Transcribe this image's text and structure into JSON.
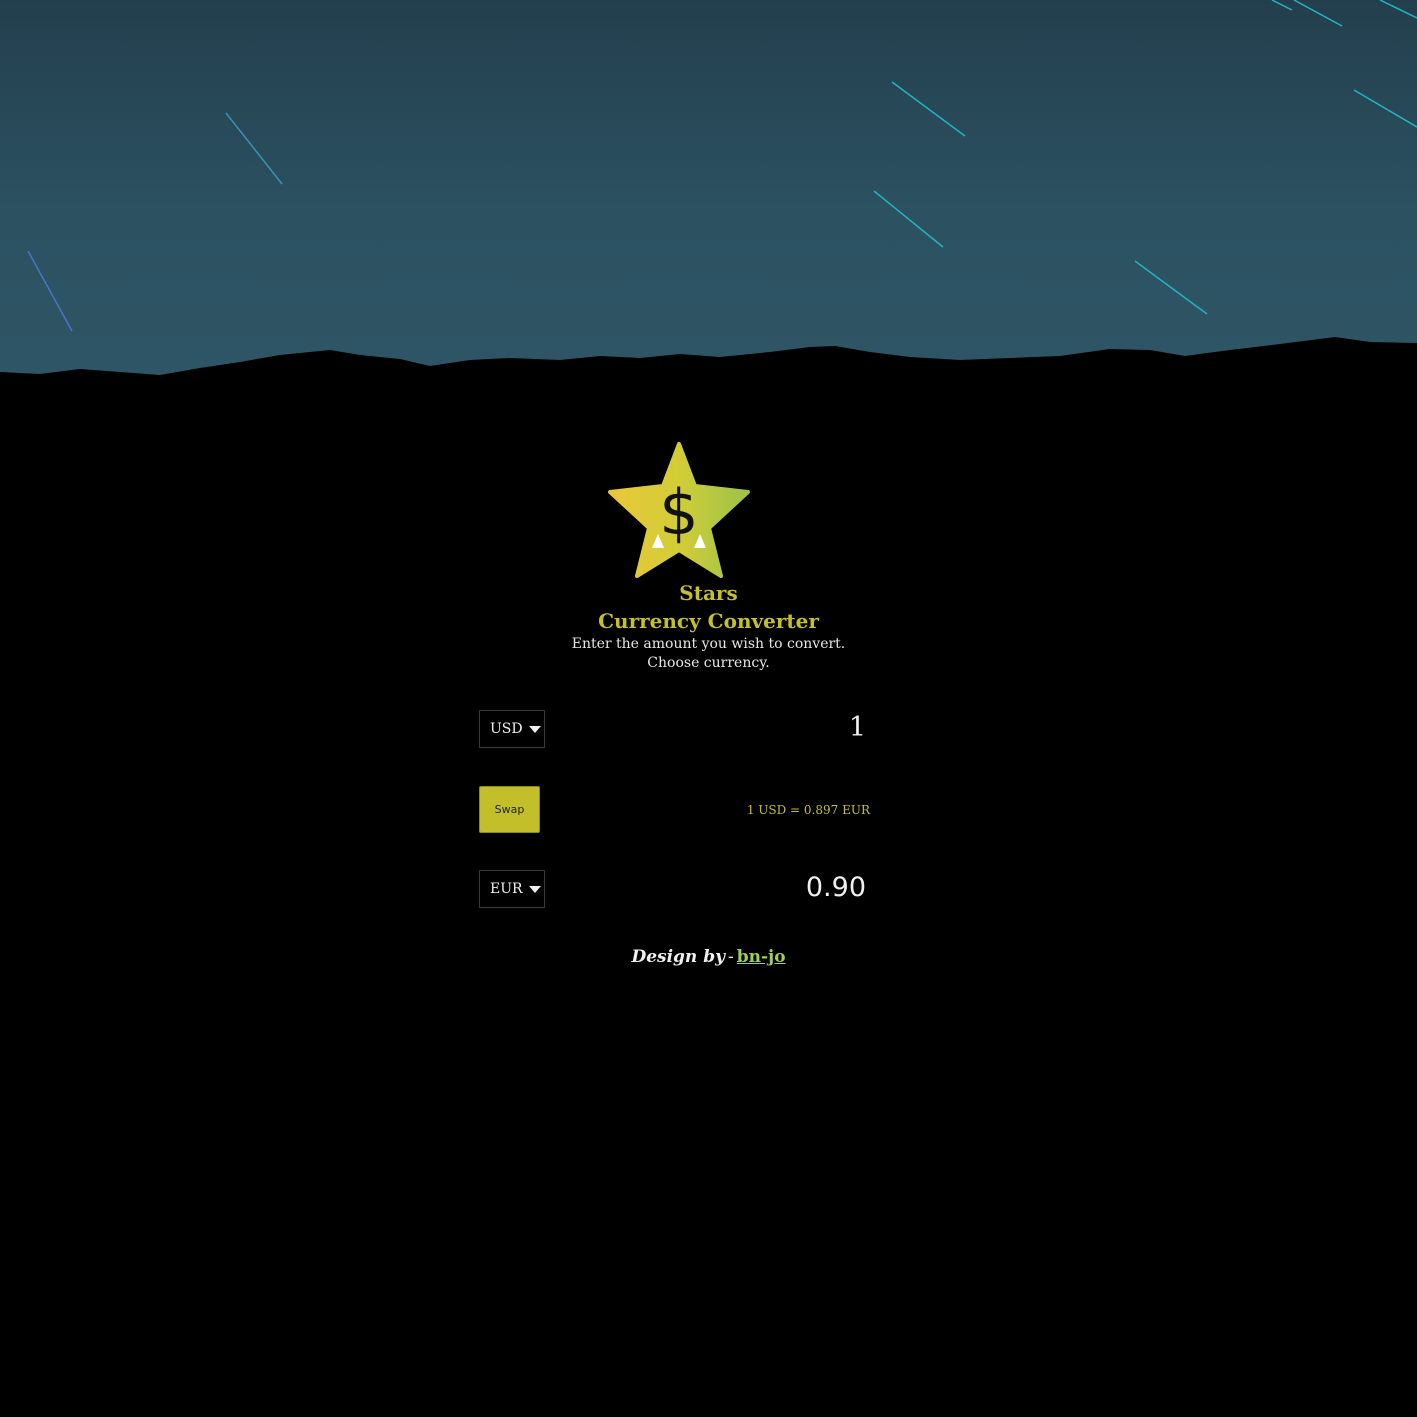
{
  "app": {
    "name": "Stars",
    "title": "Currency Converter",
    "instruction_line1": "Enter the amount you wish to convert.",
    "instruction_line2": "Choose currency."
  },
  "converter": {
    "from_currency": "USD",
    "from_amount": "1",
    "swap_label": "Swap",
    "rate_text": "1 USD = 0.897 EUR",
    "to_currency": "EUR",
    "to_amount": "0.90"
  },
  "footer": {
    "design_by_label": "Design by",
    "separator": "-",
    "author_link": "bn-jo"
  },
  "logo": {
    "icon": "star-dollar-icon",
    "symbol": "$"
  },
  "colors": {
    "accent": "#c3c02a",
    "link": "#9bd05a",
    "sky_top": "#233f4d",
    "sky_bottom": "#2f5666",
    "background": "#000000"
  }
}
